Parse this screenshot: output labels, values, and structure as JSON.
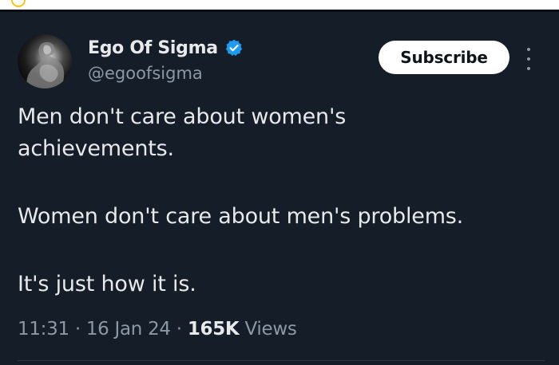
{
  "author": {
    "display_name": "Ego Of Sigma",
    "handle": "@egoofsigma",
    "avatar_icon": "statue-avatar",
    "verified_icon": "verified-badge-icon",
    "verified_color": "#1d9bf0"
  },
  "actions": {
    "subscribe_label": "Subscribe",
    "more_icon": "more-vertical-icon"
  },
  "tweet": {
    "lines": [
      "Men don't care about women's",
      "achievements.",
      "Women don't care about men's problems.",
      "It's just how it is."
    ],
    "time": "11:31",
    "date": "16 Jan 24",
    "separator": "·",
    "views_count": "165K",
    "views_label": "Views"
  },
  "colors": {
    "background": "#151d29",
    "text": "#e7e9ea",
    "secondary_text": "#8b98a5",
    "button_bg": "#ffffff"
  }
}
